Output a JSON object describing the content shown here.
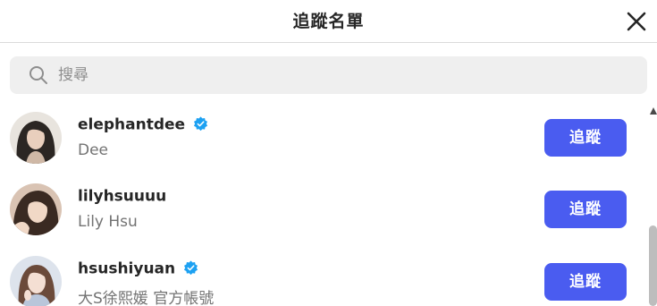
{
  "header": {
    "title": "追蹤名單"
  },
  "search": {
    "placeholder": "搜尋",
    "value": ""
  },
  "colors": {
    "follow_button": "#4a5cf0",
    "verified_badge": "#1da1f2",
    "secondary_text": "#737373"
  },
  "users": [
    {
      "username": "elephantdee",
      "verified": true,
      "full_name": "Dee",
      "button_label": "追蹤"
    },
    {
      "username": "lilyhsuuuu",
      "verified": false,
      "full_name": "Lily Hsu",
      "button_label": "追蹤"
    },
    {
      "username": "hsushiyuan",
      "verified": true,
      "full_name": "大S徐熙媛 官方帳號",
      "button_label": "追蹤"
    }
  ]
}
